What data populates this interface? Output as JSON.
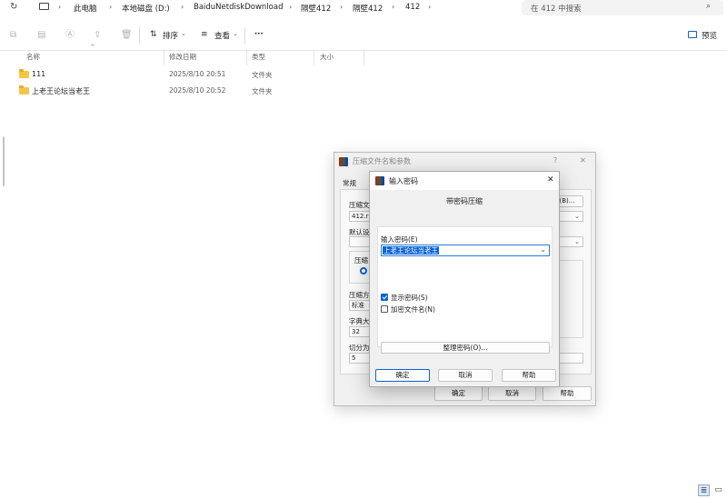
{
  "addressbar": {
    "crumbs": [
      "此电脑",
      "本地磁盘 (D:)",
      "BaiduNetdiskDownload",
      "隔壁412",
      "隔壁412",
      "412"
    ],
    "search_placeholder": "在 412 中搜索"
  },
  "toolbar": {
    "sort_label": "排序",
    "view_label": "查看",
    "more_label": "···",
    "preview_label": "预览"
  },
  "columns": {
    "name": "名称",
    "date": "修改日期",
    "type": "类型",
    "size": "大小"
  },
  "files": [
    {
      "name": "111",
      "date": "2025/8/10 20:51",
      "type": "文件夹"
    },
    {
      "name": "上老王论坛当老王",
      "date": "2025/8/10 20:52",
      "type": "文件夹"
    }
  ],
  "archive_dialog": {
    "title": "压缩文件名和参数",
    "help_q": "?",
    "close": "✕",
    "tab_general": "常规",
    "archive_name_label": "压缩文",
    "archive_name_value": "412.ra",
    "browse_suffix": "(B)...",
    "default_profile_label": "默认设",
    "archive_format_label": "压缩",
    "method_label": "压缩方",
    "method_value": "标准",
    "dict_label": "字典大",
    "dict_value": "32",
    "split_label": "切分为",
    "split_value": "5",
    "ok_label": "确定",
    "cancel_label": "取消",
    "help_label": "帮助"
  },
  "password_dialog": {
    "title": "输入密码",
    "close": "✕",
    "subtitle": "带密码压缩",
    "enter_label": "输入密码(E)",
    "password_value": "上老王论坛当老王",
    "show_password_label": "显示密码(S)",
    "show_password_checked": true,
    "encrypt_names_label": "加密文件名(N)",
    "encrypt_names_checked": false,
    "organize_label": "整理密码(O)...",
    "ok_label": "确定",
    "cancel_label": "取消",
    "help_label": "帮助"
  },
  "colors": {
    "accent": "#0a64d6",
    "folder": "#f3c64a"
  }
}
